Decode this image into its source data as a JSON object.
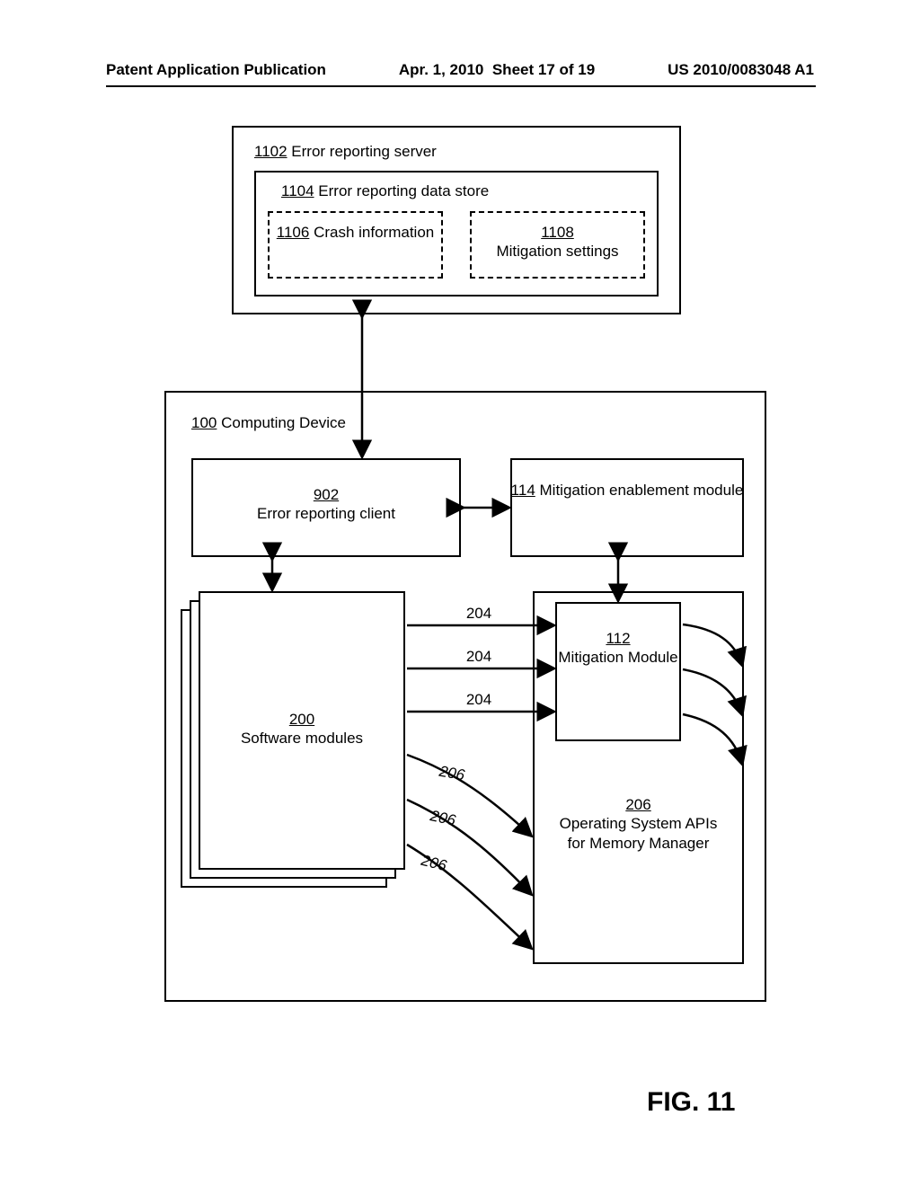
{
  "header": {
    "left": "Patent Application Publication",
    "date": "Apr. 1, 2010",
    "sheet": "Sheet 17 of 19",
    "pubno": "US 2010/0083048 A1"
  },
  "server": {
    "ref": "1102",
    "label": "Error reporting server",
    "datastore": {
      "ref": "1104",
      "label": "Error reporting data store"
    },
    "crash": {
      "ref": "1106",
      "label": "Crash information"
    },
    "mitigation": {
      "ref": "1108",
      "label": "Mitigation settings"
    }
  },
  "device": {
    "ref": "100",
    "label": "Computing Device",
    "erc": {
      "ref": "902",
      "label": "Error reporting client"
    },
    "mem": {
      "ref": "114",
      "label": "Mitigation enablement module"
    },
    "sw": {
      "ref": "200",
      "label": "Software modules"
    },
    "mm": {
      "ref": "112",
      "label": "Mitigation Module"
    },
    "os": {
      "ref": "206",
      "label": "Operating System APIs for Memory Manager"
    },
    "link204": "204",
    "link206": "206"
  },
  "figure": "FIG. 11"
}
